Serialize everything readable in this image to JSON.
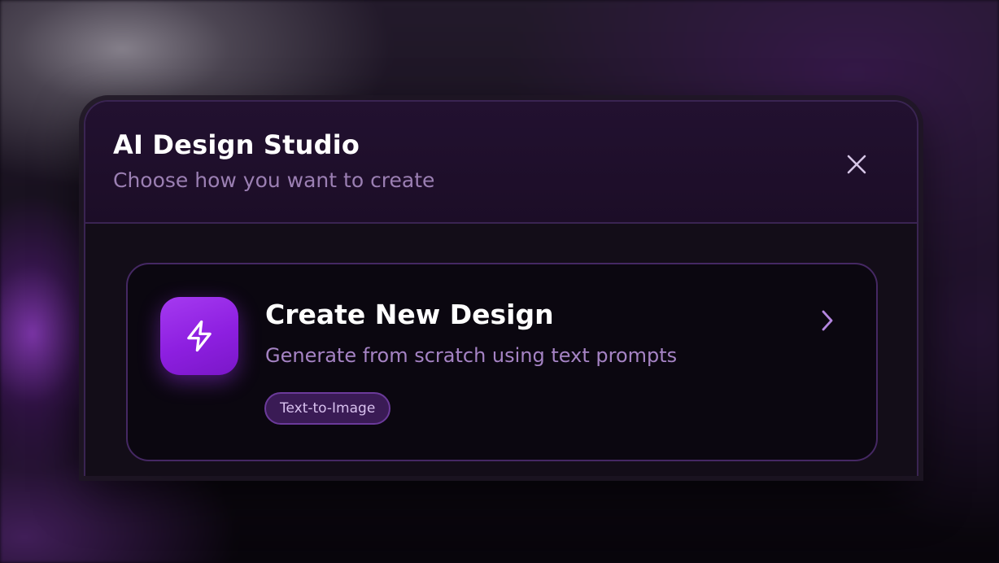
{
  "modal": {
    "title": "AI Design Studio",
    "subtitle": "Choose how you want to create",
    "close_icon": "close-icon"
  },
  "options": [
    {
      "title": "Create New Design",
      "description": "Generate from scratch using text prompts",
      "tag": "Text-to-Image",
      "icon": "lightning-bolt-icon",
      "arrow_icon": "chevron-right-icon"
    }
  ],
  "colors": {
    "accent": "#9b2ff0",
    "header_bg": "#1f0e2b",
    "card_bg": "#0b0710",
    "border": "#3a2452",
    "subtitle_text": "#9b7fb3",
    "tag_bg": "#3a1b55"
  }
}
